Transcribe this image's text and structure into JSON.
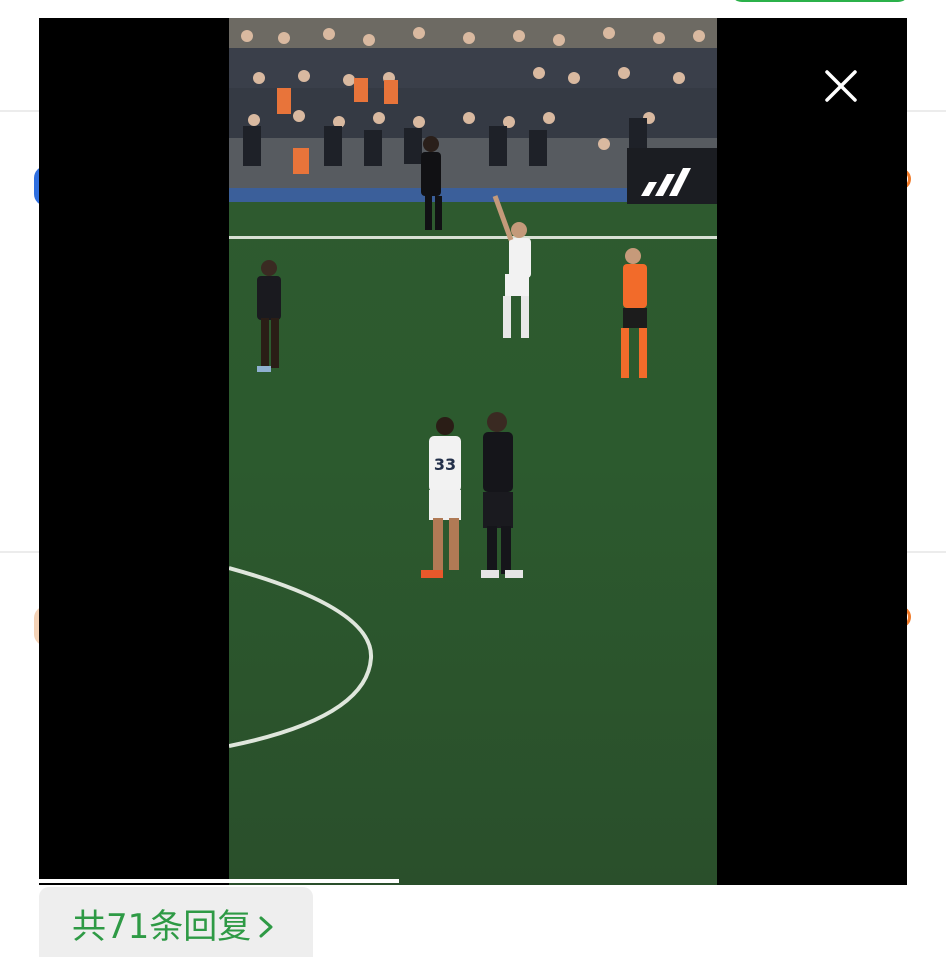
{
  "replies": {
    "label": "共71条回复"
  },
  "icons": {
    "close": "close-icon",
    "chevron": "chevron-right-icon"
  },
  "colors": {
    "accent_green": "#2e9a45",
    "viewer_bg": "#000000",
    "pill_green": "#2bb14a"
  }
}
